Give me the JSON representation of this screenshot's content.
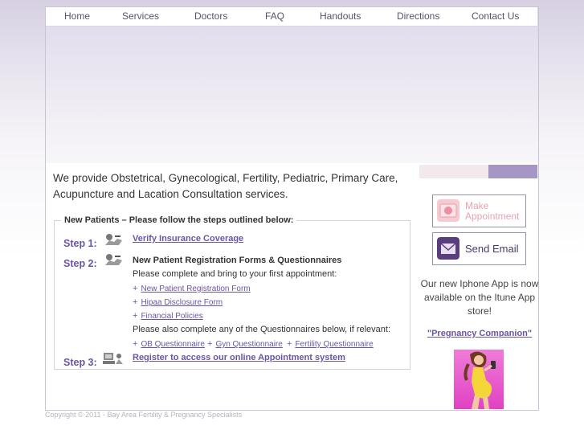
{
  "nav": {
    "items": [
      {
        "label": "Home"
      },
      {
        "label": "Services"
      },
      {
        "label": "Doctors"
      },
      {
        "label": "FAQ"
      },
      {
        "label": "Handouts"
      },
      {
        "label": "Directions"
      },
      {
        "label": "Contact Us"
      }
    ]
  },
  "intro": {
    "text": "We provide Obstetrical, Gynecological, Fertility, Pediatric, Primary Care, Acupuncture and Lacation Consultation services."
  },
  "new_patients": {
    "legend": "New Patients – Please follow the steps outlined below:",
    "step1": {
      "label": "Step 1:",
      "link": "Verify Insurance Coverage"
    },
    "step2": {
      "label": "Step 2:",
      "heading": "New Patient Registration Forms & Questionnaires",
      "instruction": "Please complete and bring to your first appointment:",
      "forms": [
        "New Patient Registration Form",
        "Hipaa Disclosure Form",
        "Financial Policies"
      ],
      "questionnaire_note": "Please also complete any of the Questionnaires below, if relevant:",
      "questionnaires": [
        "OB Questionnaire",
        "Gyn Questionnaire",
        "Fertility Questionnaire"
      ]
    },
    "step3": {
      "label": "Step 3:",
      "link": "Register to access our online Appointment system"
    },
    "bullet": "+"
  },
  "sidebar": {
    "make_appointment": {
      "line1": "Make",
      "line2": "Appointment"
    },
    "send_email": "Send Email",
    "app_text": "Our new Iphone App is now available on the Itune App store!",
    "app_link": "\"Pregnancy Companion\""
  },
  "footer": {
    "copyright": "Copyright © 2011 - Bay Area Fertility & Pregnancy Specialists"
  },
  "colors": {
    "accent": "#6a55a5",
    "tab_purple": "#a696c6",
    "tab_pink": "#f3e8ec",
    "app_pink": "#e042c3"
  }
}
